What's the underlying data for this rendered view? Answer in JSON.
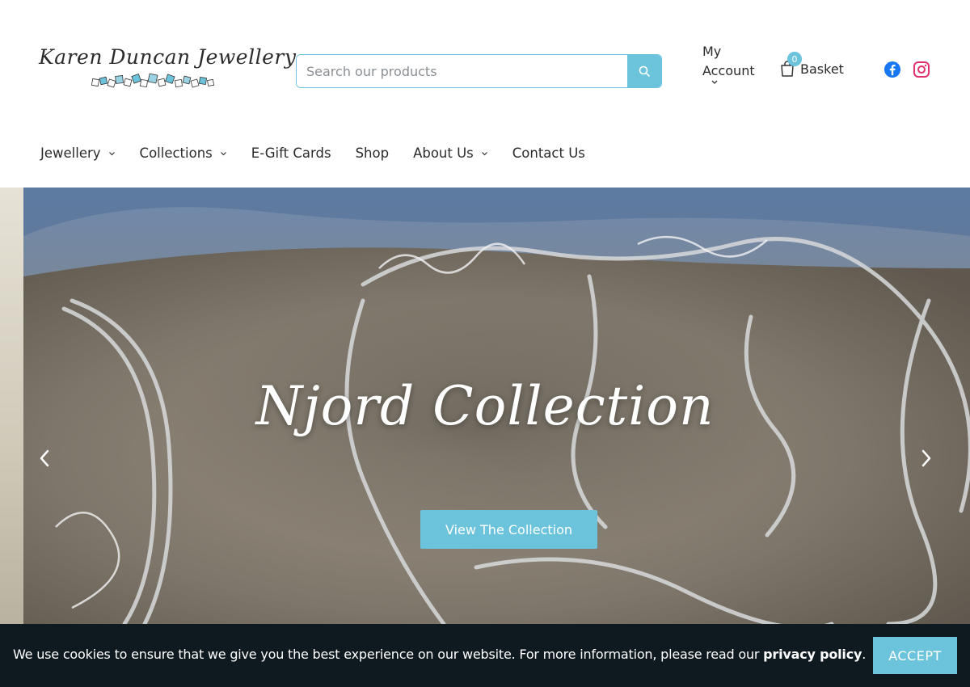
{
  "brand": {
    "logo_text": "Karen Duncan Jewellery",
    "accent_color": "#6cc4dc"
  },
  "search": {
    "placeholder": "Search our products",
    "value": "",
    "icon": "search-icon"
  },
  "account": {
    "line1": "My",
    "line2": "Account"
  },
  "basket": {
    "label": "Basket",
    "count": "0",
    "icon": "shopping-bag-icon"
  },
  "social": {
    "facebook_icon": "facebook-icon",
    "instagram_icon": "instagram-icon"
  },
  "nav": {
    "items": [
      {
        "label": "Jewellery",
        "has_dropdown": true
      },
      {
        "label": "Collections",
        "has_dropdown": true
      },
      {
        "label": "E-Gift Cards",
        "has_dropdown": false
      },
      {
        "label": "Shop",
        "has_dropdown": false
      },
      {
        "label": "About Us",
        "has_dropdown": true
      },
      {
        "label": "Contact Us",
        "has_dropdown": false
      }
    ]
  },
  "hero": {
    "title": "Njord Collection",
    "button_label": "View The Collection"
  },
  "cookie": {
    "message": "We use cookies to ensure that we give you the best experience on our website. For more information, please read our ",
    "link_text": "privacy policy",
    "suffix": ".",
    "accept_label": "ACCEPT"
  }
}
